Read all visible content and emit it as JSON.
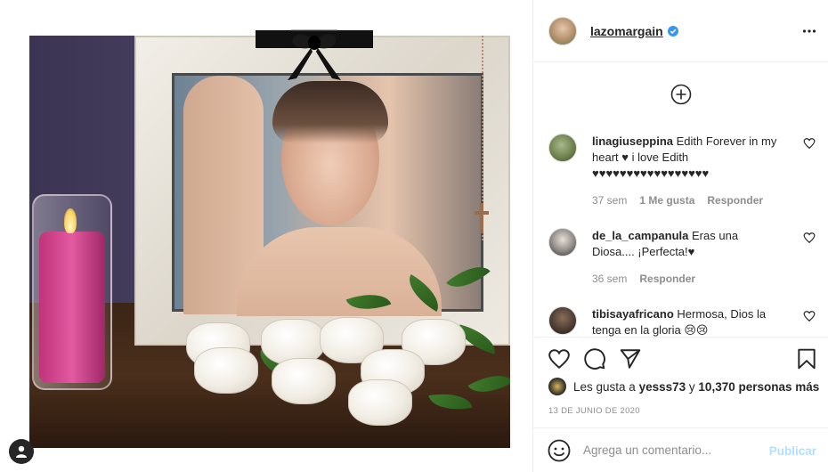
{
  "post": {
    "image_icons": {
      "bow": "black-mourning-bow-icon",
      "profile_fab": "user-icon"
    }
  },
  "header": {
    "username": "lazomargain",
    "verified_icon": "verified-badge-icon",
    "more_icon": "more-horizontal-icon"
  },
  "comments": {
    "load_more_icon": "plus-circle-icon",
    "items": [
      {
        "user": "linagiuseppina",
        "text": "Edith Forever in my heart ♥ i love Edith ♥♥♥♥♥♥♥♥♥♥♥♥♥♥♥♥♥",
        "time": "37 sem",
        "likes": "1 Me gusta",
        "reply": "Responder"
      },
      {
        "user": "de_la_campanula",
        "text": "Eras una Diosa.... ¡Perfecta!♥",
        "time": "36 sem",
        "reply": "Responder"
      },
      {
        "user": "tibisayafricano",
        "text": "Hermosa, Dios la tenga en la gloria 😢😢"
      }
    ]
  },
  "actions": {
    "like_icon": "heart-icon",
    "comment_icon": "comment-icon",
    "share_icon": "share-icon",
    "save_icon": "bookmark-icon"
  },
  "likes": {
    "prefix": "Les gusta a",
    "user": "yesss73",
    "joiner": "y",
    "count": "10,370 personas más"
  },
  "date": "13 DE JUNIO DE 2020",
  "add_comment": {
    "emoji_icon": "smiley-icon",
    "placeholder": "Agrega un comentario...",
    "publish_label": "Publicar"
  },
  "colors": {
    "text": "#262626",
    "muted": "#8e8e8e",
    "verified": "#3897f0",
    "publish_disabled": "#b2dffc",
    "heart_red": "#ed4956"
  }
}
